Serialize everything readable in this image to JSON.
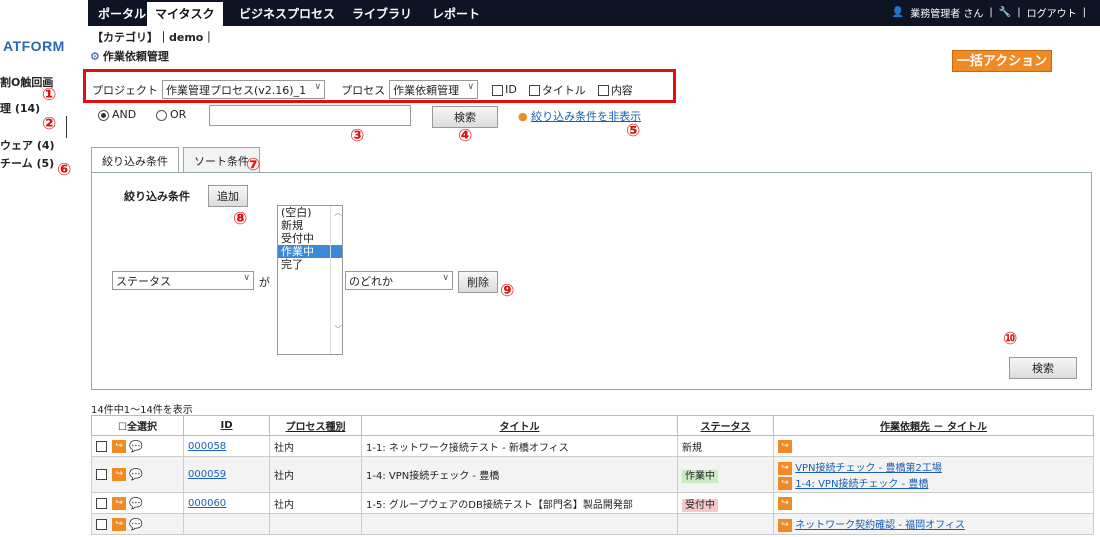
{
  "nav": {
    "tabs": [
      "ポータル",
      "マイタスク",
      "ビジネスプロセス",
      "ライブラリ",
      "レポート"
    ],
    "user": "業務管理者 さん",
    "logout": "ログアウト"
  },
  "brand": "ATFORM",
  "leftnav": {
    "l1": "割O触回画",
    "l2": "理 (14)",
    "l3": "ウェア (4)",
    "l4": "チーム (5)"
  },
  "breadcrumb": "【カテゴリ】｜demo｜",
  "page_title": "作業依頼管理",
  "bulk_action": "一括アクション",
  "filter": {
    "project_label": "プロジェクト",
    "project_value": "作業管理プロセス(v2.16)_1",
    "process_label": "プロセス",
    "process_value": "作業依頼管理",
    "cb_id": "ID",
    "cb_title": "タイトル",
    "cb_content": "内容",
    "and": "AND",
    "or": "OR",
    "search_btn": "検索",
    "hide_link": "絞り込み条件を非表示"
  },
  "tabs": {
    "t1": "絞り込み条件",
    "t2": "ソート条件"
  },
  "condition": {
    "label": "絞り込み条件",
    "add": "追加",
    "field": "ステータス",
    "ga": "が",
    "options": [
      "(空白)",
      "新規",
      "受付中",
      "作業中",
      "完了"
    ],
    "selected_option": "作業中",
    "match": "のどれか",
    "delete": "削除",
    "search": "検索"
  },
  "numbers": [
    "①",
    "②",
    "③",
    "④",
    "⑤",
    "⑥",
    "⑦",
    "⑧",
    "⑨",
    "⑩"
  ],
  "result_count": "14件中1～14件を表示",
  "table": {
    "headers": [
      "☐全選択",
      "ID",
      "プロセス種別",
      "タイトル",
      "ステータス",
      "作業依頼先 － タイトル"
    ],
    "rows": [
      {
        "id": "000058",
        "type": "社内",
        "title": "1-1: ネットワーク接続テスト - 新橋オフィス",
        "status": "新規",
        "links": []
      },
      {
        "id": "000059",
        "type": "社内",
        "title": "1-4: VPN接続チェック - 豊橋",
        "status": "作業中",
        "links": [
          "VPN接続チェック - 豊橋第2工場",
          "1-4: VPN接続チェック - 豊橋"
        ]
      },
      {
        "id": "000060",
        "type": "社内",
        "title": "1-5: グループウェアのDB接続テスト【部門名】製品開発部",
        "status": "受付中",
        "links": []
      },
      {
        "id": "",
        "type": "",
        "title": "",
        "status": "",
        "links": [
          "ネットワーク契約確認 - 福岡オフィス"
        ]
      }
    ]
  }
}
